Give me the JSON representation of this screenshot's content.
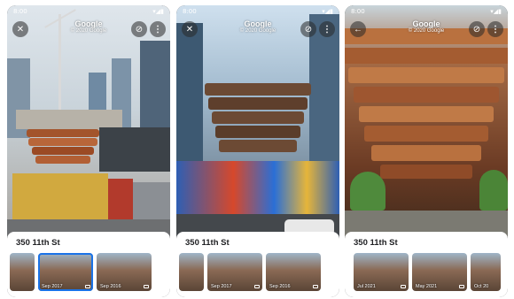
{
  "screens": [
    {
      "time": "8:00",
      "title": "Google",
      "copyright": "© 2020 Google",
      "left_button": "close-icon",
      "address": "350 11th St",
      "thumbnails": [
        {
          "label": "",
          "selected": false
        },
        {
          "label": "Sep 2017",
          "selected": true
        },
        {
          "label": "Sep 2016",
          "selected": false
        }
      ]
    },
    {
      "time": "8:00",
      "title": "Google",
      "copyright": "© 2020 Google",
      "left_button": "close-icon",
      "address": "350 11th St",
      "thumbnails": [
        {
          "label": "",
          "selected": false
        },
        {
          "label": "Sep 2017",
          "selected": false
        },
        {
          "label": "Sep 2016",
          "selected": false
        }
      ]
    },
    {
      "time": "8:00",
      "title": "Google",
      "copyright": "© 2020 Google",
      "left_button": "back-arrow-icon",
      "address": "350 11th St",
      "thumbnails": [
        {
          "label": "Jul 2021",
          "selected": false
        },
        {
          "label": "May 2021",
          "selected": false
        },
        {
          "label": "Oct 20",
          "selected": false
        }
      ]
    }
  ],
  "colors": {
    "selection": "#1a73e8",
    "sheet": "#ffffff",
    "vessel": "#b5653a"
  }
}
